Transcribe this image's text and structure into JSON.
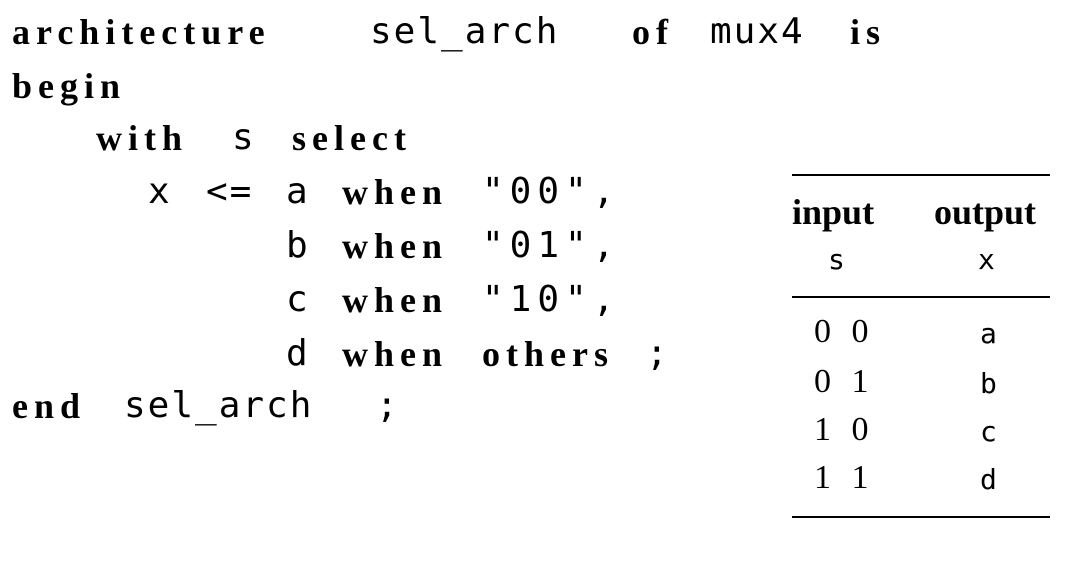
{
  "code": {
    "line1": {
      "kw_architecture": "architecture",
      "name": "sel_arch",
      "kw_of": "of",
      "entity": "mux4",
      "kw_is": "is"
    },
    "line2": {
      "kw_begin": "begin"
    },
    "line3": {
      "kw_with": "with",
      "signal": "s",
      "kw_select": "select"
    },
    "line4": {
      "target": "x",
      "op": "<=",
      "choice": "a",
      "kw_when": "when",
      "value": "\"00\","
    },
    "line5": {
      "choice": "b",
      "kw_when": "when",
      "value": "\"01\","
    },
    "line6": {
      "choice": "c",
      "kw_when": "when",
      "value": "\"10\","
    },
    "line7": {
      "choice": "d",
      "kw_when": "when",
      "kw_others": "others",
      "semi": ";"
    },
    "line8": {
      "kw_end": "end",
      "name": "sel_arch",
      "semi": ";"
    }
  },
  "truth_table": {
    "headers": [
      {
        "label": "input",
        "signal": "s"
      },
      {
        "label": "output",
        "signal": "x"
      }
    ],
    "rows": [
      {
        "input": "0 0",
        "output": "a"
      },
      {
        "input": "0 1",
        "output": "b"
      },
      {
        "input": "1 0",
        "output": "c"
      },
      {
        "input": "1 1",
        "output": "d"
      }
    ]
  }
}
